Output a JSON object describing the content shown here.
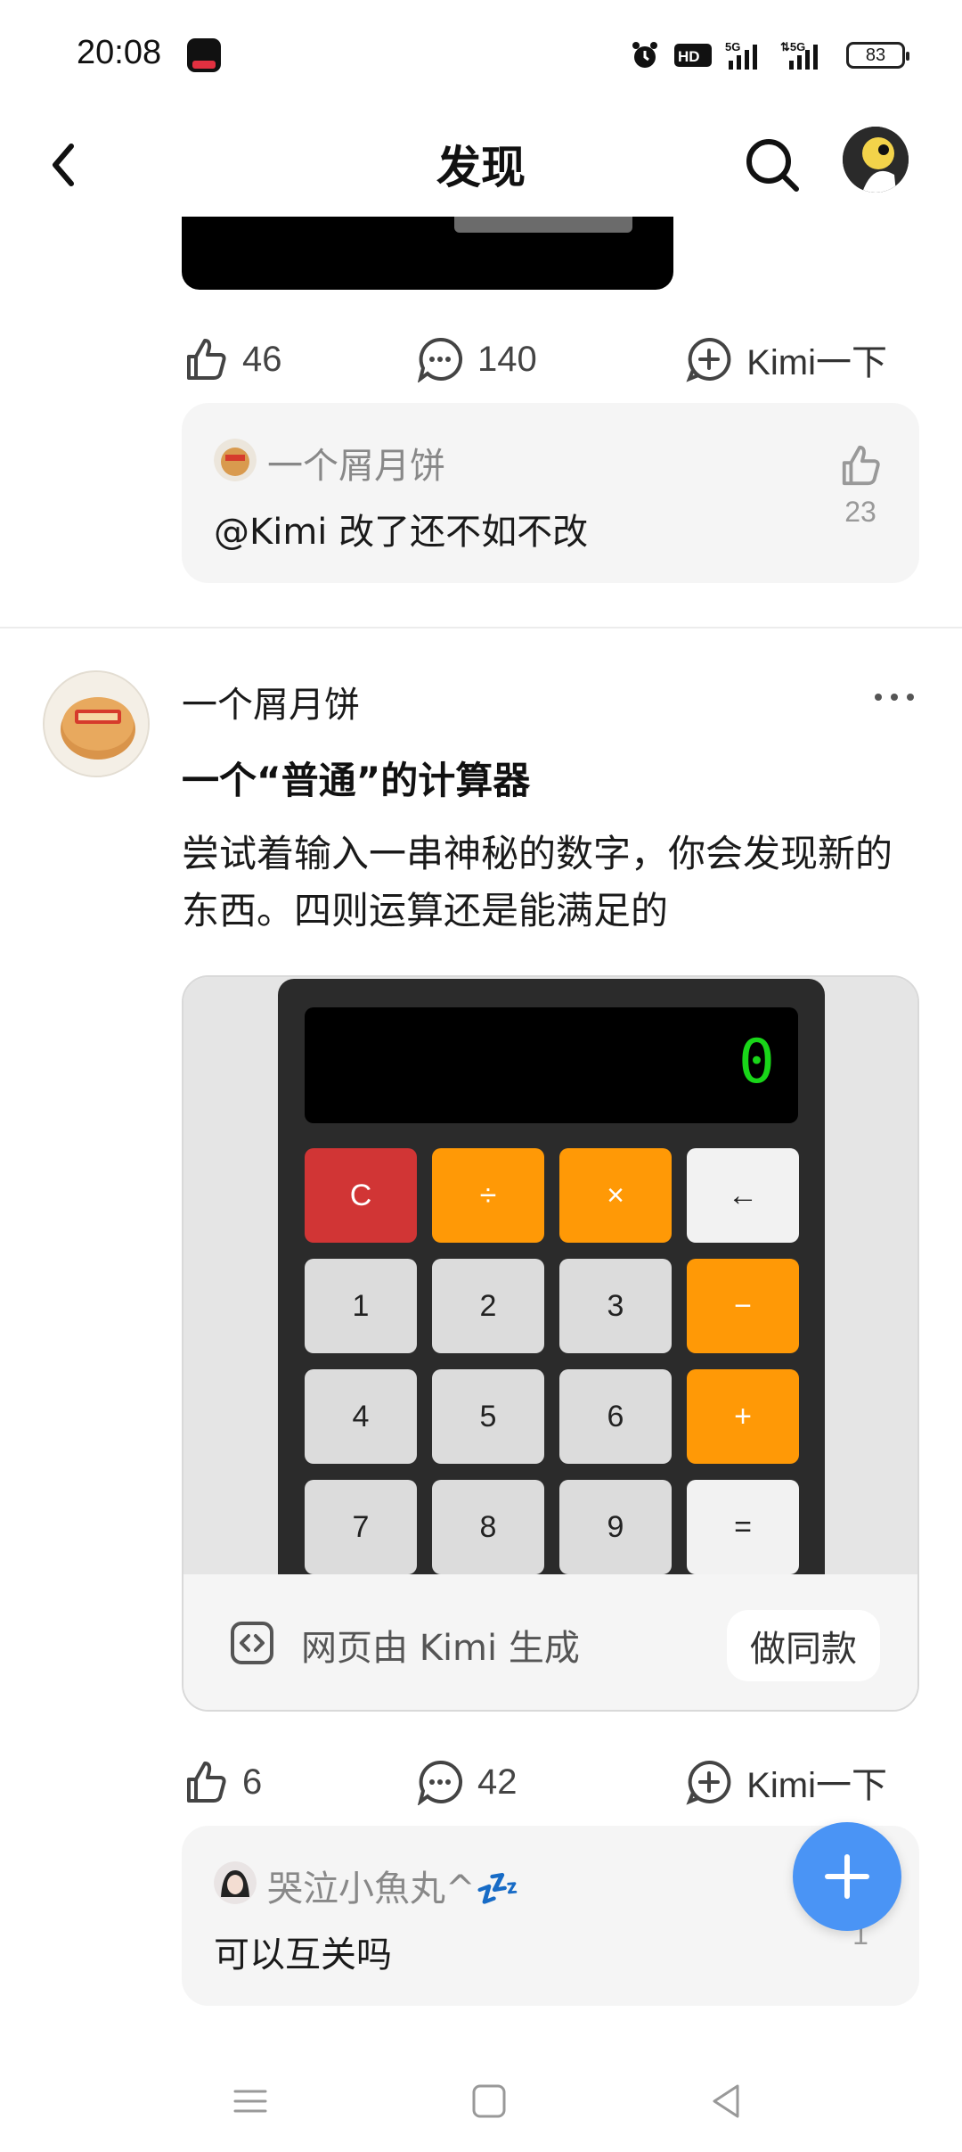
{
  "status_bar": {
    "time": "20:08",
    "battery": "83",
    "icons": [
      "tiktok-app-icon",
      "alarm-icon",
      "hd-icon",
      "5g-signal-icon",
      "5g-signal-icon",
      "battery-icon"
    ]
  },
  "nav": {
    "title": "发现",
    "back_icon": "chevron-left-icon",
    "search_icon": "search-icon",
    "avatar_icon": "user-avatar"
  },
  "prev_post": {
    "likes": "46",
    "comments": "140",
    "kimi_label": "Kimi一下",
    "top_comment": {
      "user": "一个屑月饼",
      "text": "@Kimi 改了还不如不改",
      "likes": "23"
    }
  },
  "post": {
    "user": "一个屑月饼",
    "title": "一个“普通”的计算器",
    "body": "尝试着输入一串神秘的数字，你会发现新的东西。四则运算还是能满足的",
    "preview": {
      "display": "0",
      "keys": [
        "C",
        "÷",
        "×",
        "←",
        "1",
        "2",
        "3",
        "−",
        "4",
        "5",
        "6",
        "+",
        "7",
        "8",
        "9",
        "="
      ],
      "footer_text": "网页由 Kimi 生成",
      "footer_button": "做同款"
    },
    "likes": "6",
    "comments": "42",
    "kimi_label": "Kimi一下",
    "top_comment": {
      "user": "哭泣小魚丸^💤",
      "text": "可以互关吗",
      "likes": "1"
    }
  },
  "colors": {
    "fab": "#4a94f5",
    "calc_red": "#d13535",
    "calc_orange": "#ff9906",
    "display_green": "#19d619"
  }
}
